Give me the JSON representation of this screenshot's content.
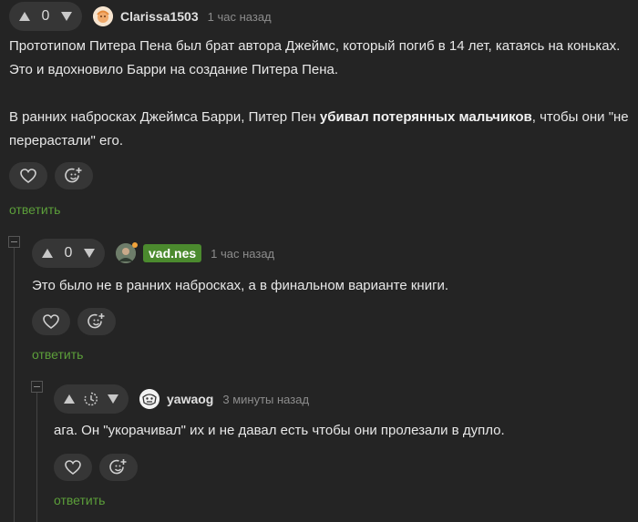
{
  "comments": [
    {
      "votes": "0",
      "username": "Clarissa1503",
      "time": "1 час назад",
      "paragraph1": "Прототипом Питера Пена был брат автора Джеймс, который погиб в 14 лет, катаясь на коньках. Это и вдохновило Барри на создание Питера Пена.",
      "p2_before": "В ранних набросках Джеймса Барри, Питер Пен ",
      "p2_bold": "убивал потерянных мальчиков",
      "p2_after": ", чтобы они \"не перерастали\" его.",
      "reply": "ответить"
    },
    {
      "votes": "0",
      "username": "vad.nes",
      "time": "1 час назад",
      "text": "Это было не в ранних набросках, а в финальном варианте книги.",
      "reply": "ответить"
    },
    {
      "username": "yawaog",
      "time": "3 минуты назад",
      "text": "ага. Он \"укорачивал\" их и не давал есть чтобы они пролезали в дупло.",
      "reply": "ответить"
    }
  ],
  "colors": {
    "background": "#242424",
    "pill": "#363636",
    "accent_green": "#5c9f3a",
    "badge_green": "#4b8a2e"
  },
  "icons": [
    "upvote-icon",
    "downvote-icon",
    "clock-icon",
    "heart-icon",
    "emoji-add-icon",
    "collapse-icon"
  ]
}
